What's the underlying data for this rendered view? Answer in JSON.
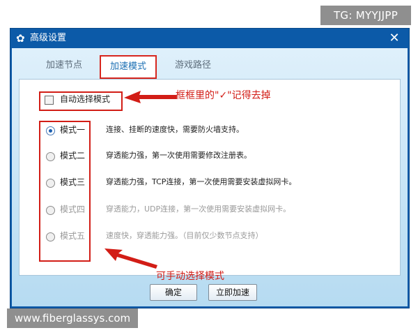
{
  "tg_badge": "TG: MYYJJPP",
  "window": {
    "title": "高级设置",
    "title_icon": "gear-icon",
    "close_glyph": "✕"
  },
  "tabs": [
    {
      "label": "加速节点",
      "active": false
    },
    {
      "label": "加速模式",
      "active": true
    },
    {
      "label": "游戏路径",
      "active": false
    }
  ],
  "auto_select": {
    "label": "自动选择模式",
    "checked": false
  },
  "modes": [
    {
      "label": "模式一",
      "desc": "连接、挂断的速度快，需要防火墙支持。",
      "selected": true,
      "enabled": true
    },
    {
      "label": "模式二",
      "desc": "穿透能力强，第一次使用需要修改注册表。",
      "selected": false,
      "enabled": true
    },
    {
      "label": "模式三",
      "desc": "穿透能力强，TCP连接，第一次使用需要安装虚拟网卡。",
      "selected": false,
      "enabled": true
    },
    {
      "label": "模式四",
      "desc": "穿透能力，UDP连接，第一次使用需要安装虚拟网卡。",
      "selected": false,
      "enabled": false
    },
    {
      "label": "模式五",
      "desc": "速度快，穿透能力强。（目前仅少数节点支持）",
      "selected": false,
      "enabled": false
    }
  ],
  "annotations": {
    "top": "框框里的\"✓\"记得去掉",
    "bottom": "可手动选择模式"
  },
  "buttons": {
    "ok": "确定",
    "accelerate": "立即加速"
  },
  "watermark": "www.fiberglassys.com",
  "colors": {
    "title_bar": "#0c5aa8",
    "annotation_red": "#d21d16",
    "selected_radio": "#1d5fb0"
  }
}
